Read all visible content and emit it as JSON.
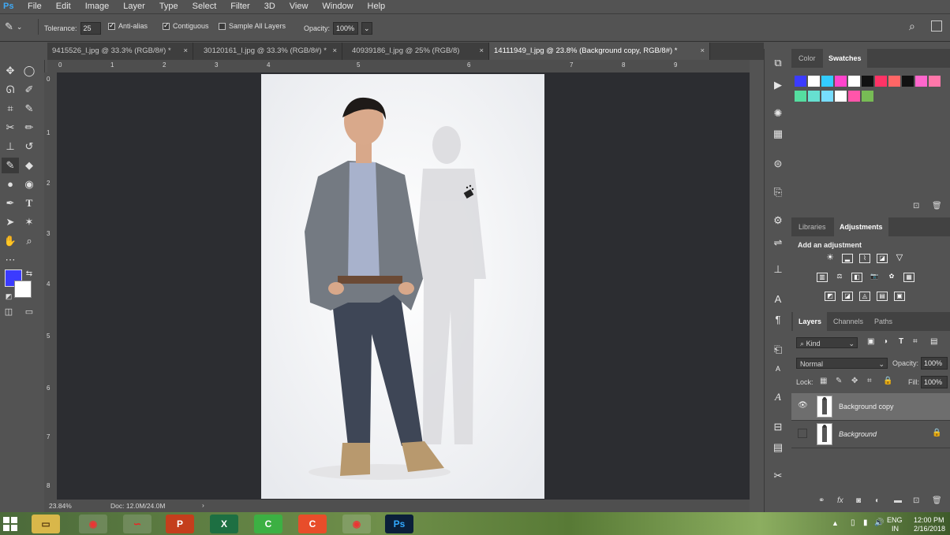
{
  "app": {
    "logo": "Ps"
  },
  "menu": [
    "File",
    "Edit",
    "Image",
    "Layer",
    "Type",
    "Select",
    "Filter",
    "3D",
    "View",
    "Window",
    "Help"
  ],
  "options": {
    "tolerance_label": "Tolerance:",
    "tolerance_value": "25",
    "anti_alias": "Anti-alias",
    "contiguous": "Contiguous",
    "sample_all": "Sample All Layers",
    "opacity_label": "Opacity:",
    "opacity_value": "100%"
  },
  "tabs": [
    {
      "label": "9415526_l.jpg @ 33.3% (RGB/8#) *"
    },
    {
      "label": "30120161_l.jpg @ 33.3% (RGB/8#) *"
    },
    {
      "label": "40939186_l.jpg @ 25% (RGB/8)"
    },
    {
      "label": "14111949_l.jpg @ 23.8% (Background copy, RGB/8#) *"
    }
  ],
  "ruler_top": [
    "0",
    "1",
    "2",
    "3",
    "4",
    "5",
    "6",
    "7",
    "8",
    "9"
  ],
  "ruler_left": [
    "0",
    "1",
    "2",
    "3",
    "4",
    "5",
    "6",
    "7",
    "8"
  ],
  "status": {
    "zoom": "23.84%",
    "doc": "Doc: 12.0M/24.0M"
  },
  "colors": {
    "foreground": "#3b3bff",
    "background": "#ffffff",
    "swatches_row1": [
      "#3b3bff",
      "#ffffff",
      "#33ccff",
      "#ff44cc",
      "#ffffff",
      "#111111",
      "#ff3366",
      "#ff6666",
      "#111111",
      "#ff66cc",
      "#ff77aa"
    ],
    "swatches_row2": [
      "#55dda0",
      "#66e0d0",
      "#77ddff",
      "#ffffff",
      "#ff55aa",
      "#77bb55"
    ]
  },
  "color_panel": {
    "tab_color": "Color",
    "tab_swatches": "Swatches"
  },
  "adjust_panel": {
    "tab_libraries": "Libraries",
    "tab_adjustments": "Adjustments",
    "heading": "Add an adjustment"
  },
  "layers_panel": {
    "tab_layers": "Layers",
    "tab_channels": "Channels",
    "tab_paths": "Paths",
    "kind": "Kind",
    "blend_mode": "Normal",
    "opacity_label": "Opacity:",
    "opacity_value": "100%",
    "lock_label": "Lock:",
    "fill_label": "Fill:",
    "fill_value": "100%",
    "layers": [
      {
        "name": "Background copy"
      },
      {
        "name": "Background"
      }
    ]
  },
  "taskbar": {
    "apps": [
      "explorer",
      "chrome",
      "airtel",
      "powerpoint",
      "excel",
      "camtasia",
      "camtasia-recorder",
      "chrome",
      "photoshop"
    ],
    "lang": "ENG",
    "region": "IN",
    "time": "12:00 PM",
    "date": "2/16/2018"
  }
}
